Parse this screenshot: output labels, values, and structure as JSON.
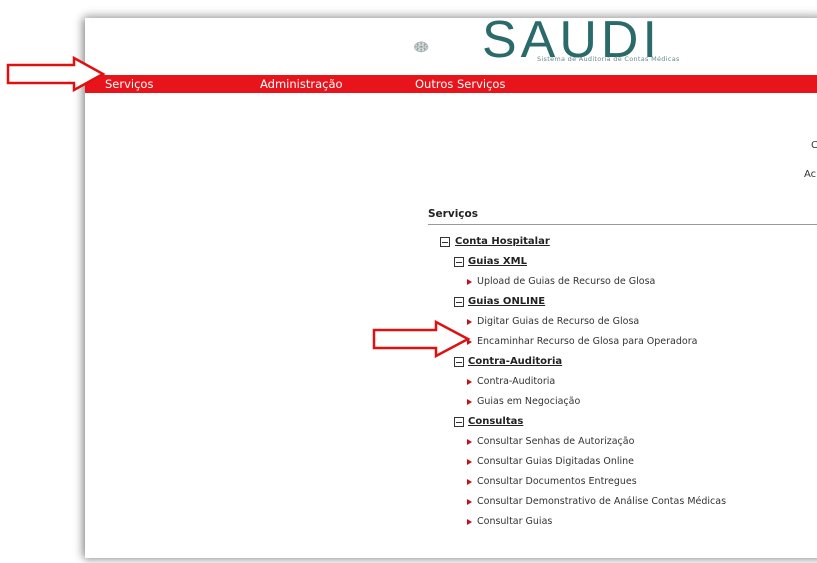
{
  "logo": {
    "title": "SAUDI",
    "subtitle": "Sistema de Auditoria de Contas Médicas"
  },
  "nav": [
    {
      "label": "Serviços"
    },
    {
      "label": "Administração"
    },
    {
      "label": "Outros Serviços"
    }
  ],
  "side": [
    "C",
    "Ac"
  ],
  "section": {
    "title": "Serviços"
  },
  "tree": {
    "root": "Conta Hospitalar",
    "groups": [
      {
        "label": "Guias XML",
        "items": [
          "Upload de Guias de Recurso de Glosa"
        ]
      },
      {
        "label": "Guias ONLINE",
        "items": [
          "Digitar Guias de Recurso de Glosa",
          "Encaminhar Recurso de Glosa para Operadora"
        ]
      },
      {
        "label": "Contra-Auditoria",
        "items": [
          "Contra-Auditoria",
          "Guias em Negociação"
        ]
      },
      {
        "label": "Consultas",
        "items": [
          "Consultar Senhas de Autorização",
          "Consultar Guias Digitadas Online",
          "Consultar Documentos Entregues",
          "Consultar Demonstrativo de Análise Contas Médicas",
          "Consultar Guias"
        ]
      }
    ]
  },
  "colors": {
    "navbar": "#e8141c",
    "arrow": "#e01010",
    "bullet": "#c0101a"
  }
}
